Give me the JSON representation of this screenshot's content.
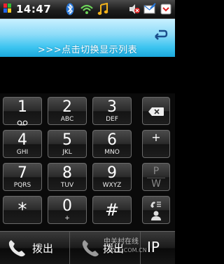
{
  "status_bar": {
    "time": "14:47"
  },
  "header": {
    "hint": ">>>点击切换显示列表"
  },
  "keypad": {
    "keys": [
      {
        "num": "1",
        "sub": "oo"
      },
      {
        "num": "2",
        "sub": "ABC"
      },
      {
        "num": "3",
        "sub": "DEF"
      },
      {
        "num": "4",
        "sub": "GHI"
      },
      {
        "num": "5",
        "sub": "JKL"
      },
      {
        "num": "6",
        "sub": "MNO"
      },
      {
        "num": "7",
        "sub": "PQRS"
      },
      {
        "num": "8",
        "sub": "TUV"
      },
      {
        "num": "9",
        "sub": "WXYZ"
      },
      {
        "num": "*",
        "sub": ""
      },
      {
        "num": "0",
        "sub": "+"
      },
      {
        "num": "#",
        "sub": ""
      }
    ],
    "side": {
      "plus": "+",
      "p": "P",
      "w": "W"
    }
  },
  "bottom_bar": {
    "call_label": "拨出",
    "ip_call_label": "拨出",
    "ip_label": "IP"
  },
  "watermark": {
    "text": "中关村在线",
    "url": "ZOL.COM.CN"
  }
}
